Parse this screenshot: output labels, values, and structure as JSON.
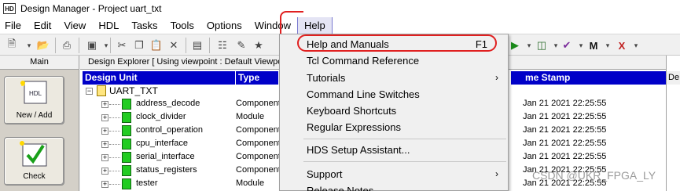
{
  "window": {
    "title": "Design Manager - Project uart_txt",
    "icon_text": "HD"
  },
  "menubar": {
    "items": [
      "File",
      "Edit",
      "View",
      "HDL",
      "Tasks",
      "Tools",
      "Options",
      "Window",
      "Help"
    ]
  },
  "left_pane": {
    "header": "Main",
    "buttons": [
      {
        "label": "New / Add",
        "icon": "hdl-document-icon",
        "icon_text": "HDL"
      },
      {
        "label": "Check",
        "icon": "checkmark-icon"
      }
    ]
  },
  "explorer": {
    "header": "Design Explorer [ Using viewpoint :  Default Viewpoint",
    "columns": {
      "unit": "Design Unit",
      "type": "Type",
      "time": "me Stamp",
      "right": "De"
    },
    "root": "UART_TXT",
    "rows": [
      {
        "name": "address_decode",
        "type": "Component",
        "time": "Jan 21 2021 22:25:55"
      },
      {
        "name": "clock_divider",
        "type": "Module",
        "time": "Jan 21 2021 22:25:55"
      },
      {
        "name": "control_operation",
        "type": "Component",
        "time": "Jan 21 2021 22:25:55"
      },
      {
        "name": "cpu_interface",
        "type": "Component",
        "time": "Jan 21 2021 22:25:55"
      },
      {
        "name": "serial_interface",
        "type": "Component",
        "time": "Jan 21 2021 22:25:55"
      },
      {
        "name": "status_registers",
        "type": "Component",
        "time": "Jan 21 2021 22:25:55"
      },
      {
        "name": "tester",
        "type": "Module",
        "time": "Jan 21 2021 22:25:55"
      }
    ]
  },
  "help_menu": {
    "items": [
      {
        "label": "Help and Manuals",
        "shortcut": "F1"
      },
      {
        "label": "Tcl Command Reference"
      },
      {
        "label": "Tutorials",
        "submenu": true
      },
      {
        "label": "Command Line Switches"
      },
      {
        "label": "Keyboard Shortcuts"
      },
      {
        "label": "Regular Expressions"
      },
      {
        "label": "HDS Setup Assistant..."
      },
      {
        "label": "Support",
        "submenu": true
      },
      {
        "label": "Release Notes"
      }
    ],
    "submenu_arrow": "›"
  },
  "watermark": "CSDN @UKR_FPGA_LY",
  "colors": {
    "header_blue": "#0000c8",
    "annotation_red": "#e02020",
    "unit_green": "#22cc22"
  }
}
